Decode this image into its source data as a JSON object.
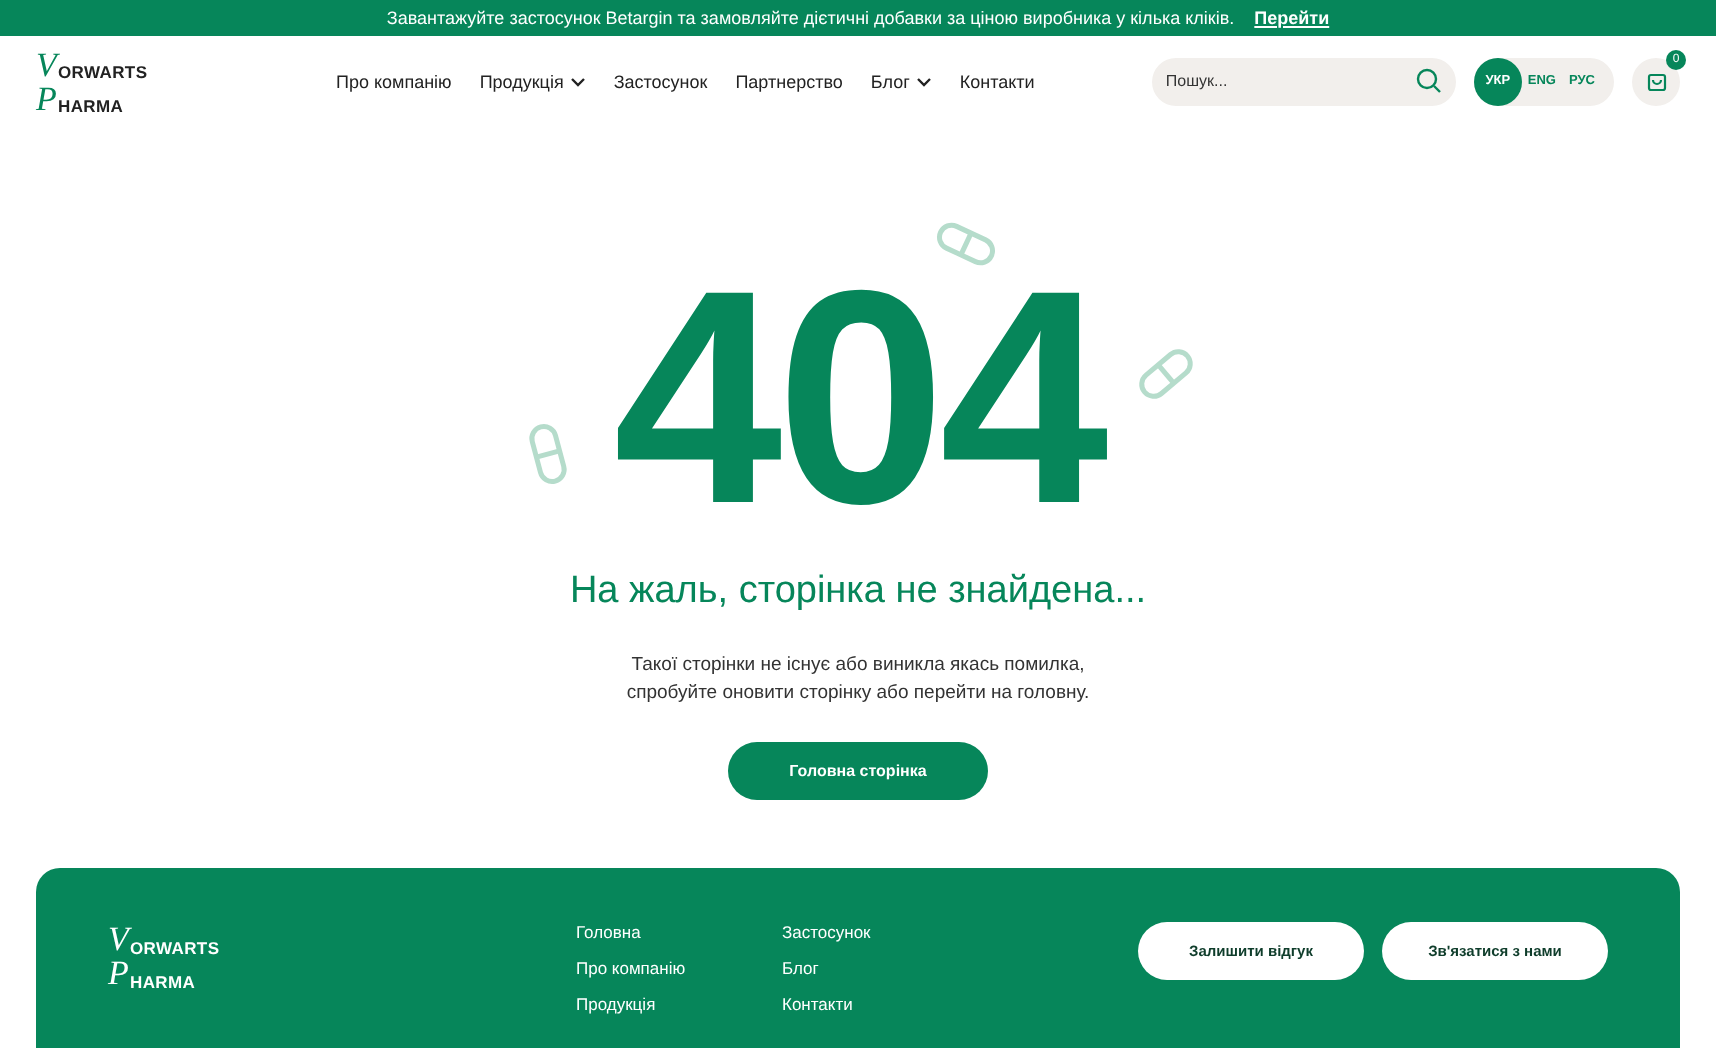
{
  "banner": {
    "text": "Завантажуйте застосунок Betargin та замовляйте дієтичні добавки за ціною виробника у кілька кліків.",
    "link": "Перейти"
  },
  "logo": {
    "initial_top": "V",
    "line_top": "ORWARTS",
    "initial_bottom": "P",
    "line_bottom": "HARMA"
  },
  "nav": [
    {
      "label": "Про компанію",
      "dropdown": false
    },
    {
      "label": "Продукція",
      "dropdown": true
    },
    {
      "label": "Застосунок",
      "dropdown": false
    },
    {
      "label": "Партнерство",
      "dropdown": false
    },
    {
      "label": "Блог",
      "dropdown": true
    },
    {
      "label": "Контакти",
      "dropdown": false
    }
  ],
  "search": {
    "placeholder": "Пошук..."
  },
  "languages": [
    {
      "label": "УКР",
      "selected": true
    },
    {
      "label": "ENG",
      "selected": false
    },
    {
      "label": "РУС",
      "selected": false
    }
  ],
  "cart": {
    "count": "0"
  },
  "error": {
    "code": "404",
    "title": "На жаль, сторінка не знайдена...",
    "message_lines": [
      "Такої сторінки не існує або виникла якась помилка,",
      "спробуйте оновити сторінку або перейти на головну."
    ],
    "button": "Головна сторінка"
  },
  "footer": {
    "logo": {
      "initial_top": "V",
      "line_top": "ORWARTS",
      "initial_bottom": "P",
      "line_bottom": "HARMA"
    },
    "link_columns": [
      [
        "Головна",
        "Про компанію",
        "Продукція"
      ],
      [
        "Застосунок",
        "Блог",
        "Контакти"
      ]
    ],
    "buttons": [
      "Залишити відгук",
      "Зв'язатися з нами"
    ]
  }
}
